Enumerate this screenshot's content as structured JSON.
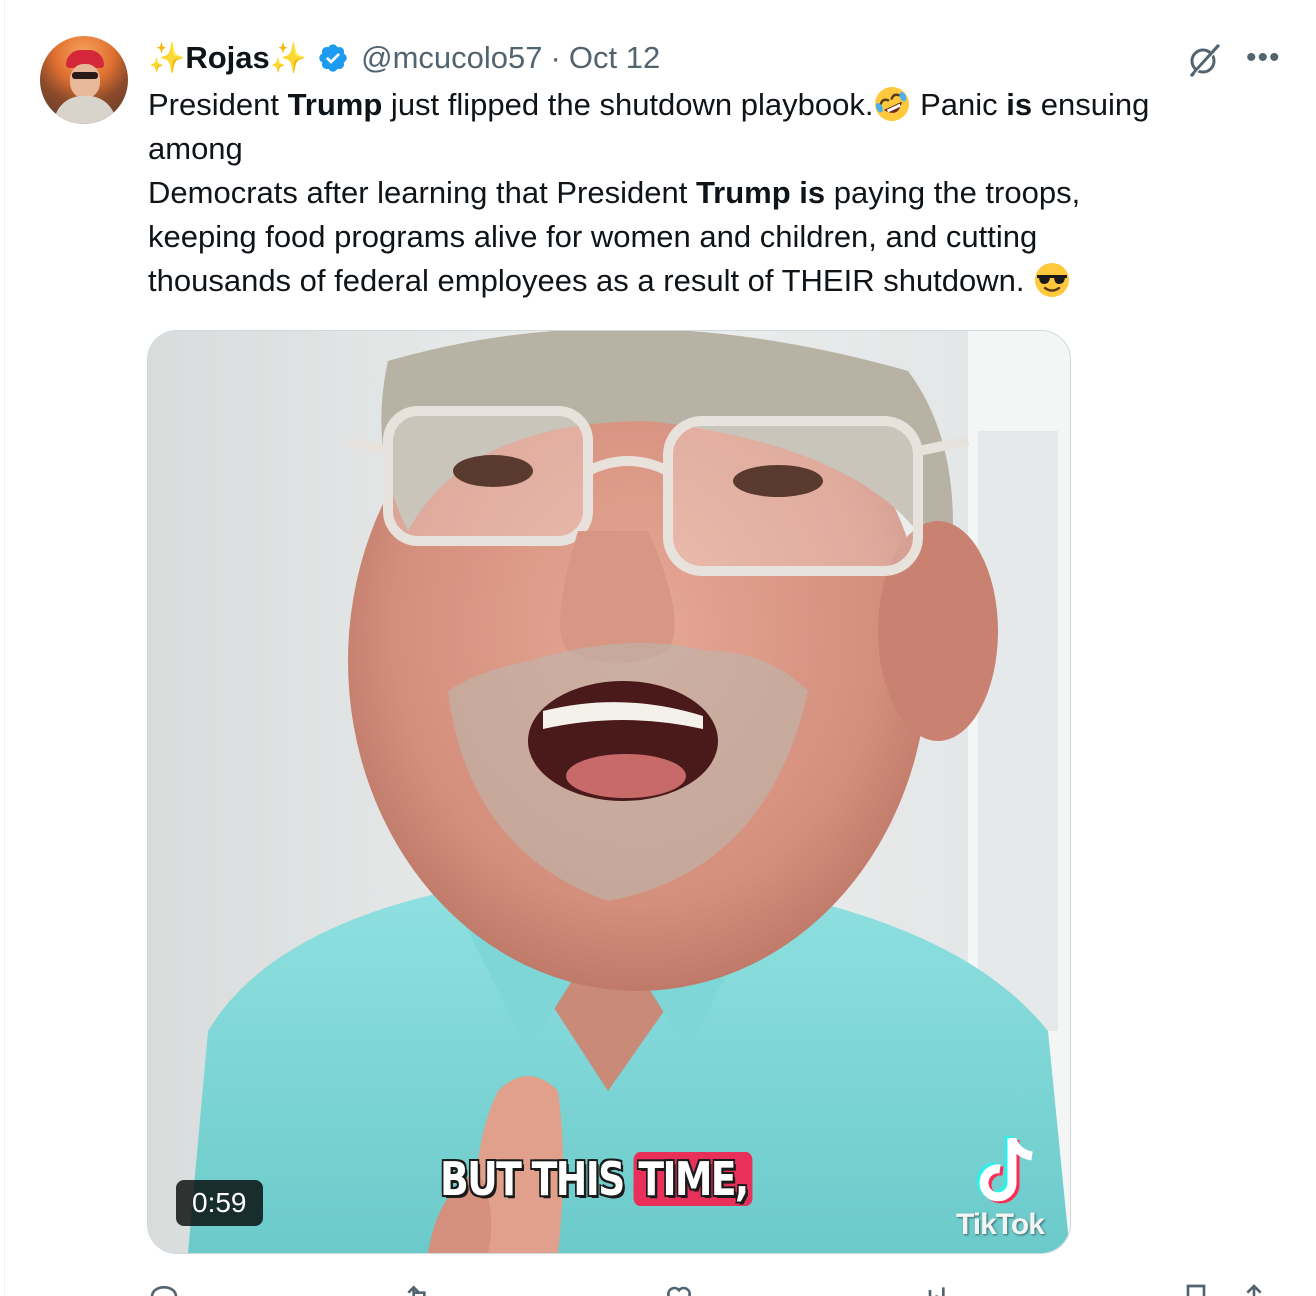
{
  "author": {
    "name": "Rojas",
    "name_prefix": "✨",
    "name_suffix": "✨",
    "handle": "@mcucolo57",
    "separator": "·",
    "date": "Oct 12",
    "verified": true
  },
  "tweet": {
    "line1": {
      "a": "President ",
      "b": "Trump",
      "c": " just flipped the shutdown playbook.",
      "d": " Panic ",
      "e": "is",
      "f": " ensuing"
    },
    "line2": "among",
    "line3": {
      "a": "Democrats after learning that President ",
      "b": "Trump is",
      "c": " paying the troops,"
    },
    "line4": "keeping food programs alive for women and children, and cutting",
    "line5": "thousands of federal employees as a result of THEIR shutdown. ",
    "emoji1": "rolling-on-the-floor-laughing",
    "emoji2": "smiling-face-with-sunglasses"
  },
  "media": {
    "caption_plain": "BUT THIS",
    "caption_highlight": "TIME,",
    "duration": "0:59",
    "watermark": "TikTok",
    "highlight_color": "#e8305a"
  },
  "actions": {
    "reply_icon": "reply-icon",
    "retweet_icon": "retweet-icon",
    "like_icon": "like-icon",
    "views_icon": "views-icon",
    "bookmark_icon": "bookmark-icon",
    "share_icon": "share-icon"
  },
  "colors": {
    "verified_blue": "#1d9bf0",
    "secondary_text": "#536471",
    "primary_text": "#0f1419"
  }
}
